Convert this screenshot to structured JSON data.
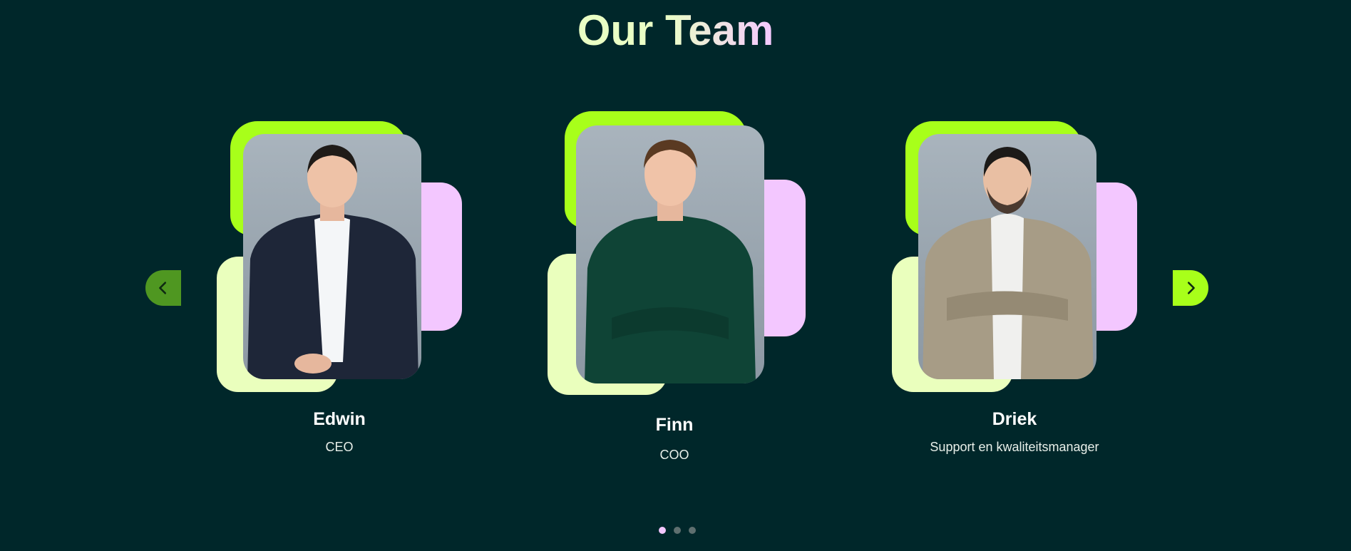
{
  "section": {
    "title": "Our Team"
  },
  "members": [
    {
      "name": "Edwin",
      "role": "CEO",
      "jacket_color": "#1e2638",
      "shirt_color": "#f4f6f8"
    },
    {
      "name": "Finn",
      "role": "COO",
      "jacket_color": "#0f4436",
      "shirt_color": "#0f4436"
    },
    {
      "name": "Driek",
      "role": "Support en kwaliteitsmanager",
      "jacket_color": "#a79c86",
      "shirt_color": "#f0f0ee"
    }
  ],
  "carousel": {
    "prev_icon": "chevron-left-icon",
    "next_icon": "chevron-right-icon",
    "page_count": 3,
    "active_page": 1
  },
  "colors": {
    "background": "#00272a",
    "accent_green": "#a8ff1a",
    "accent_pink": "#f3c7ff",
    "accent_cream": "#eaffbd"
  }
}
